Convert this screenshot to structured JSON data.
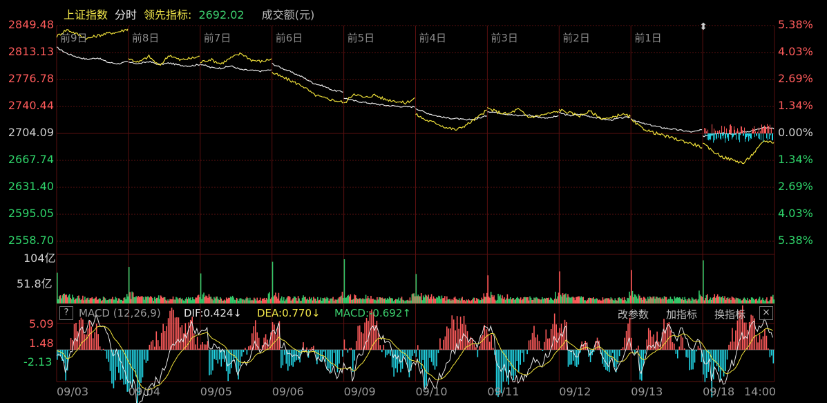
{
  "header": {
    "index_name": "上证指数",
    "mode": "分时",
    "lead_label": "领先指标:",
    "lead_value": "2692.02",
    "volume_label": "成交额(元)"
  },
  "price_axis": {
    "left_labels": [
      "2849.48",
      "2813.13",
      "2776.78",
      "2740.44",
      "2704.09",
      "2667.74",
      "2631.40",
      "2595.05",
      "2558.70"
    ],
    "right_labels": [
      "5.38%",
      "4.03%",
      "2.69%",
      "1.34%",
      "0.00%",
      "1.34%",
      "2.69%",
      "4.03%",
      "5.38%"
    ]
  },
  "day_labels": [
    "前9日",
    "前8日",
    "前7日",
    "前6日",
    "前5日",
    "前4日",
    "前3日",
    "前2日",
    "前1日"
  ],
  "volume_axis": {
    "labels": [
      "104亿",
      "51.8亿"
    ]
  },
  "macd_bar": {
    "help": "?",
    "title": "MACD (12,26,9)",
    "dif": "DIF:0.424↓",
    "dea": "DEA:0.770↓",
    "macd": "MACD:-0.692↑",
    "btn_params": "改参数",
    "btn_add": "加指标",
    "btn_switch": "换指标",
    "btn_close": "×"
  },
  "macd_axis": {
    "labels": [
      "5.09",
      "1.48",
      "-2.13"
    ]
  },
  "x_labels": [
    "09/03",
    "09/04",
    "09/05",
    "09/06",
    "09/09",
    "09/10",
    "09/11",
    "09/12",
    "09/13",
    "09/18",
    "14:00"
  ],
  "colors": {
    "index_line": "#e8e8e8",
    "lead_line": "#f1e23a",
    "up": "#ff5b5b",
    "down": "#22d6e6",
    "vol_down": "#34c86a",
    "grid": "#5a1010"
  },
  "chart_data": {
    "type": "line",
    "title": "上证指数",
    "base_close": 2704.09,
    "ylim": [
      2558.7,
      2849.48
    ],
    "sessions": [
      "09/03",
      "09/04",
      "09/05",
      "09/06",
      "09/09",
      "09/10",
      "09/11",
      "09/12",
      "09/13",
      "09/18"
    ],
    "series": [
      {
        "name": "上证指数",
        "session_values": [
          [
            2820,
            2812,
            2807,
            2804,
            2806,
            2800,
            2798,
            2801
          ],
          [
            2800,
            2798,
            2801,
            2797,
            2799,
            2796,
            2795,
            2797
          ],
          [
            2798,
            2793,
            2792,
            2795,
            2790,
            2789,
            2788,
            2790
          ],
          [
            2798,
            2792,
            2786,
            2780,
            2772,
            2768,
            2762,
            2760
          ],
          [
            2752,
            2748,
            2746,
            2744,
            2742,
            2741,
            2740,
            2740
          ],
          [
            2738,
            2732,
            2728,
            2725,
            2724,
            2722,
            2724,
            2728
          ],
          [
            2734,
            2732,
            2730,
            2728,
            2729,
            2726,
            2725,
            2728
          ],
          [
            2732,
            2728,
            2730,
            2727,
            2724,
            2722,
            2725,
            2726
          ],
          [
            2724,
            2718,
            2715,
            2712,
            2710,
            2708,
            2706,
            2709
          ],
          [
            2700,
            2704,
            2705,
            2703,
            2706,
            2708,
            2712,
            2710
          ]
        ]
      },
      {
        "name": "领先指标",
        "session_values": [
          [
            2835,
            2844,
            2838,
            2832,
            2836,
            2839,
            2841,
            2845
          ],
          [
            2805,
            2800,
            2808,
            2795,
            2810,
            2803,
            2805,
            2808
          ],
          [
            2800,
            2804,
            2798,
            2806,
            2812,
            2803,
            2801,
            2805
          ],
          [
            2786,
            2780,
            2774,
            2768,
            2757,
            2752,
            2749,
            2746
          ],
          [
            2744,
            2758,
            2752,
            2756,
            2750,
            2748,
            2745,
            2752
          ],
          [
            2730,
            2722,
            2718,
            2712,
            2709,
            2716,
            2725,
            2736
          ],
          [
            2738,
            2733,
            2730,
            2737,
            2726,
            2728,
            2731,
            2734
          ],
          [
            2736,
            2732,
            2728,
            2734,
            2725,
            2724,
            2730,
            2727
          ],
          [
            2722,
            2712,
            2706,
            2702,
            2698,
            2694,
            2690,
            2685
          ],
          [
            2690,
            2680,
            2672,
            2668,
            2664,
            2678,
            2694,
            2692
          ]
        ]
      }
    ],
    "volume_ylim": [
      0,
      104
    ],
    "volume_unit": "亿",
    "macd": {
      "dif": 0.424,
      "dea": 0.77,
      "macd": -0.692,
      "ylim": [
        -2.13,
        5.09
      ],
      "params": [
        12,
        26,
        9
      ]
    }
  }
}
